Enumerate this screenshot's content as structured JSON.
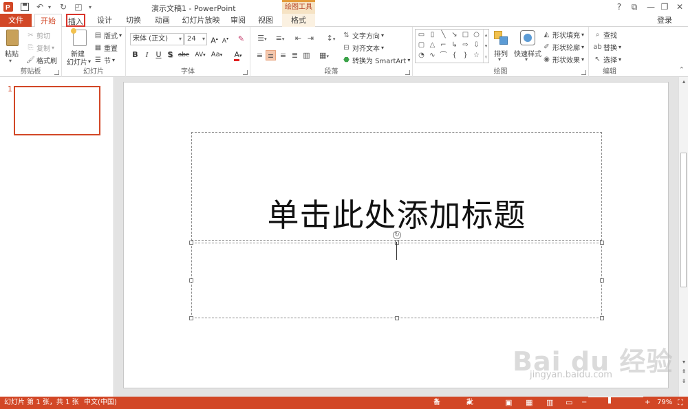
{
  "window": {
    "title": "演示文稿1 - PowerPoint",
    "context_tool_header": "绘图工具",
    "help": "?",
    "controls": [
      "⧉",
      "—",
      "❐",
      "✕"
    ]
  },
  "quick_access": {
    "icons": [
      "save-icon",
      "undo-icon",
      "redo-icon",
      "start-from-beginning-icon",
      "customize-icon"
    ]
  },
  "tabs": {
    "file": "文件",
    "items": [
      "开始",
      "插入",
      "设计",
      "切换",
      "动画",
      "幻灯片放映",
      "审阅",
      "视图",
      "格式"
    ],
    "active": "开始",
    "highlighted": "插入",
    "login": "登录"
  },
  "ribbon": {
    "clipboard": {
      "label": "剪贴板",
      "paste": "粘贴",
      "cut": "剪切",
      "copy": "复制",
      "format_painter": "格式刷"
    },
    "slides": {
      "label": "幻灯片",
      "new_slide_line1": "新建",
      "new_slide_line2": "幻灯片",
      "layout": "版式",
      "reset": "重置",
      "section": "节"
    },
    "font": {
      "label": "字体",
      "font_name": "宋体 (正文)",
      "font_size": "24",
      "bold": "B",
      "italic": "I",
      "underline": "U",
      "shadow": "S",
      "strikethrough": "abc",
      "spacing": "AV",
      "case": "Aa",
      "font_color": "A",
      "grow": "A",
      "shrink": "A"
    },
    "paragraph": {
      "label": "段落",
      "text_direction": "文字方向",
      "align_text": "对齐文本",
      "convert_smartart": "转换为 SmartArt"
    },
    "drawing": {
      "label": "绘图",
      "arrange": "排列",
      "quick_styles": "快速样式",
      "shape_fill": "形状填充",
      "shape_outline": "形状轮廓",
      "shape_effects": "形状效果"
    },
    "editing": {
      "label": "编辑",
      "find": "查找",
      "replace": "替换",
      "select": "选择"
    }
  },
  "thumbnails": {
    "slide_number": "1"
  },
  "slide": {
    "title_placeholder": "单击此处添加标题"
  },
  "watermark": {
    "logo": "Bai du 经验",
    "url": "jingyan.baidu.com"
  },
  "status": {
    "slide_info": "幻灯片 第 1 张，共 1 张",
    "language": "中文(中国)",
    "notes": "备注",
    "comments": "批注",
    "zoom_minus": "−",
    "zoom_plus": "+",
    "zoom": "79%"
  },
  "colors": {
    "accent": "#d24726",
    "highlight_box": "#d9342b",
    "context_tab": "#f6e3c4"
  }
}
